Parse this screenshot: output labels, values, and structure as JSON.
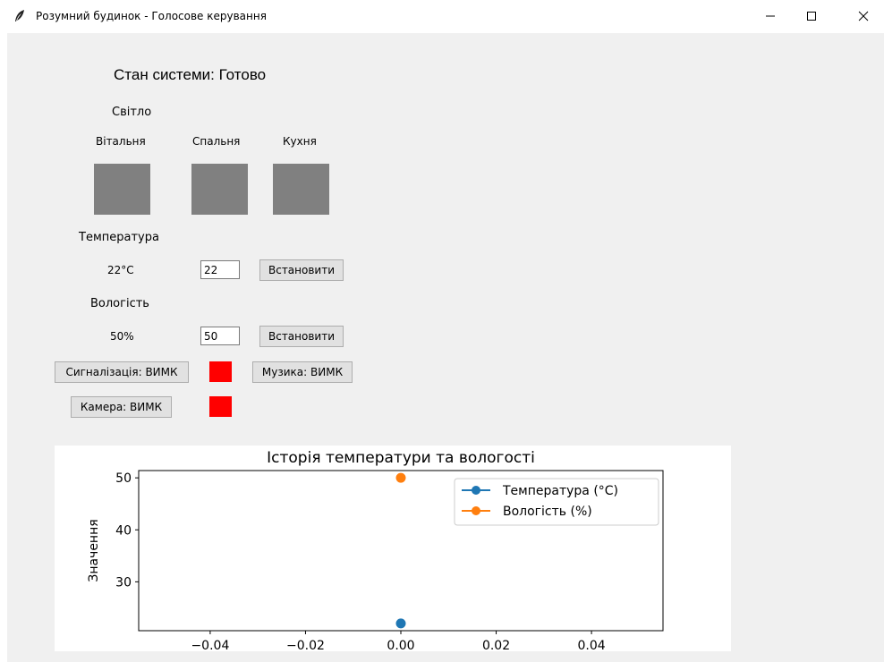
{
  "window": {
    "title": "Розумний будинок - Голосове керування",
    "icon": "feather-icon",
    "controls": [
      "minimize-icon",
      "maximize-icon",
      "close-icon"
    ]
  },
  "status": {
    "text": "Стан системи: Готово"
  },
  "lights": {
    "heading": "Світло",
    "rooms": [
      {
        "label": "Вітальня",
        "color": "#808080"
      },
      {
        "label": "Спальня",
        "color": "#808080"
      },
      {
        "label": "Кухня",
        "color": "#808080"
      }
    ]
  },
  "temperature": {
    "heading": "Температура",
    "current": "22°C",
    "input_value": "22",
    "button": "Встановити"
  },
  "humidity": {
    "heading": "Вологість",
    "current": "50%",
    "input_value": "50",
    "button": "Встановити"
  },
  "alarm": {
    "button": "Сигналізація: ВИМК",
    "indicator_color": "#ff0000"
  },
  "music": {
    "button": "Музика: ВИМК"
  },
  "camera": {
    "button": "Камера: ВИМК",
    "indicator_color": "#ff0000"
  },
  "chart_data": {
    "type": "line",
    "title": "Історія температури та вологості",
    "xlabel": "",
    "ylabel": "Значення",
    "xlim": [
      -0.055,
      0.055
    ],
    "ylim": [
      20.6,
      51.4
    ],
    "x_ticks": [
      -0.04,
      -0.02,
      0.0,
      0.02,
      0.04
    ],
    "x_tick_labels": [
      "−0.04",
      "−0.02",
      "0.00",
      "0.02",
      "0.04"
    ],
    "y_ticks": [
      30,
      40,
      50
    ],
    "y_tick_labels": [
      "30",
      "40",
      "50"
    ],
    "grid": false,
    "legend_position": "top-right",
    "series": [
      {
        "name": "Температура (°C)",
        "color": "#1f77b4",
        "x": [
          0
        ],
        "values": [
          22
        ]
      },
      {
        "name": "Вологість (%)",
        "color": "#ff7f0e",
        "x": [
          0
        ],
        "values": [
          50
        ]
      }
    ]
  }
}
